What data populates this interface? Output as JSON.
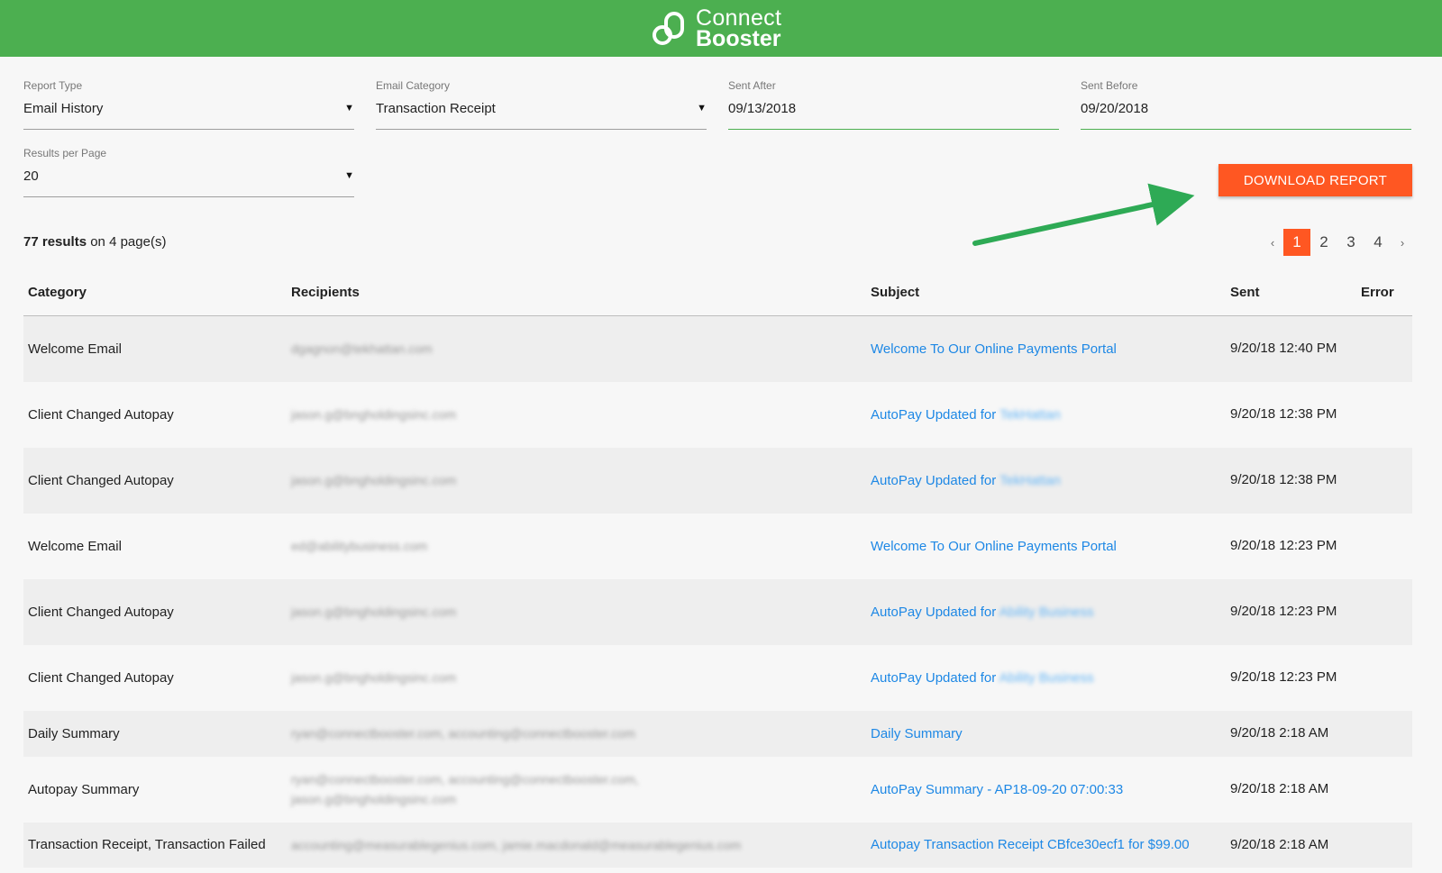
{
  "header": {
    "logo_line1": "Connect",
    "logo_line2": "Booster"
  },
  "filters": {
    "report_type": {
      "label": "Report Type",
      "value": "Email History"
    },
    "email_category": {
      "label": "Email Category",
      "value": "Transaction Receipt"
    },
    "sent_after": {
      "label": "Sent After",
      "value": "09/13/2018"
    },
    "sent_before": {
      "label": "Sent Before",
      "value": "09/20/2018"
    },
    "results_per_page": {
      "label": "Results per Page",
      "value": "20"
    }
  },
  "download_button": "DOWNLOAD REPORT",
  "summary": {
    "count": "77 results",
    "suffix": "on 4 page(s)"
  },
  "pagination": {
    "prev": "‹",
    "pages": [
      "1",
      "2",
      "3",
      "4"
    ],
    "active": "1",
    "next": "›"
  },
  "table": {
    "headers": [
      "Category",
      "Recipients",
      "Subject",
      "Sent",
      "Error"
    ],
    "rows": [
      {
        "category": "Welcome Email",
        "recipients": "dgagnon@tekhattan.com",
        "subject": "Welcome To Our Online Payments Portal",
        "subject_blur": "",
        "sent": "9/20/18 12:40 PM"
      },
      {
        "category": "Client Changed Autopay",
        "recipients": "jason.g@bngholdingsinc.com",
        "subject": "AutoPay Updated for ",
        "subject_blur": "TekHattan",
        "sent": "9/20/18 12:38 PM"
      },
      {
        "category": "Client Changed Autopay",
        "recipients": "jason.g@bngholdingsinc.com",
        "subject": "AutoPay Updated for ",
        "subject_blur": "TekHattan",
        "sent": "9/20/18 12:38 PM"
      },
      {
        "category": "Welcome Email",
        "recipients": "ed@abilitybusiness.com",
        "subject": "Welcome To Our Online Payments Portal",
        "subject_blur": "",
        "sent": "9/20/18 12:23 PM"
      },
      {
        "category": "Client Changed Autopay",
        "recipients": "jason.g@bngholdingsinc.com",
        "subject": "AutoPay Updated for ",
        "subject_blur": "Ability Business",
        "sent": "9/20/18 12:23 PM"
      },
      {
        "category": "Client Changed Autopay",
        "recipients": "jason.g@bngholdingsinc.com",
        "subject": "AutoPay Updated for ",
        "subject_blur": "Ability Business",
        "sent": "9/20/18 12:23 PM"
      },
      {
        "category": "Daily Summary",
        "recipients": "ryan@connectbooster.com, accounting@connectbooster.com",
        "subject": "Daily Summary",
        "subject_blur": "",
        "sent": "9/20/18 2:18 AM"
      },
      {
        "category": "Autopay Summary",
        "recipients": "ryan@connectbooster.com, accounting@connectbooster.com, jason.g@bngholdingsinc.com",
        "subject": "AutoPay Summary - AP18-09-20 07:00:33",
        "subject_blur": "",
        "sent": "9/20/18 2:18 AM"
      },
      {
        "category": "Transaction Receipt, Transaction Failed",
        "recipients": "accounting@measurablegenius.com, jamie.macdonald@measurablegenius.com",
        "subject": "Autopay Transaction Receipt CBfce30ecf1 for $99.00",
        "subject_blur": "",
        "sent": "9/20/18 2:18 AM"
      }
    ]
  },
  "colors": {
    "header_green": "#4caf50",
    "accent_orange": "#ff5722",
    "link_blue": "#1e88e5",
    "arrow_green": "#2eaa55"
  }
}
